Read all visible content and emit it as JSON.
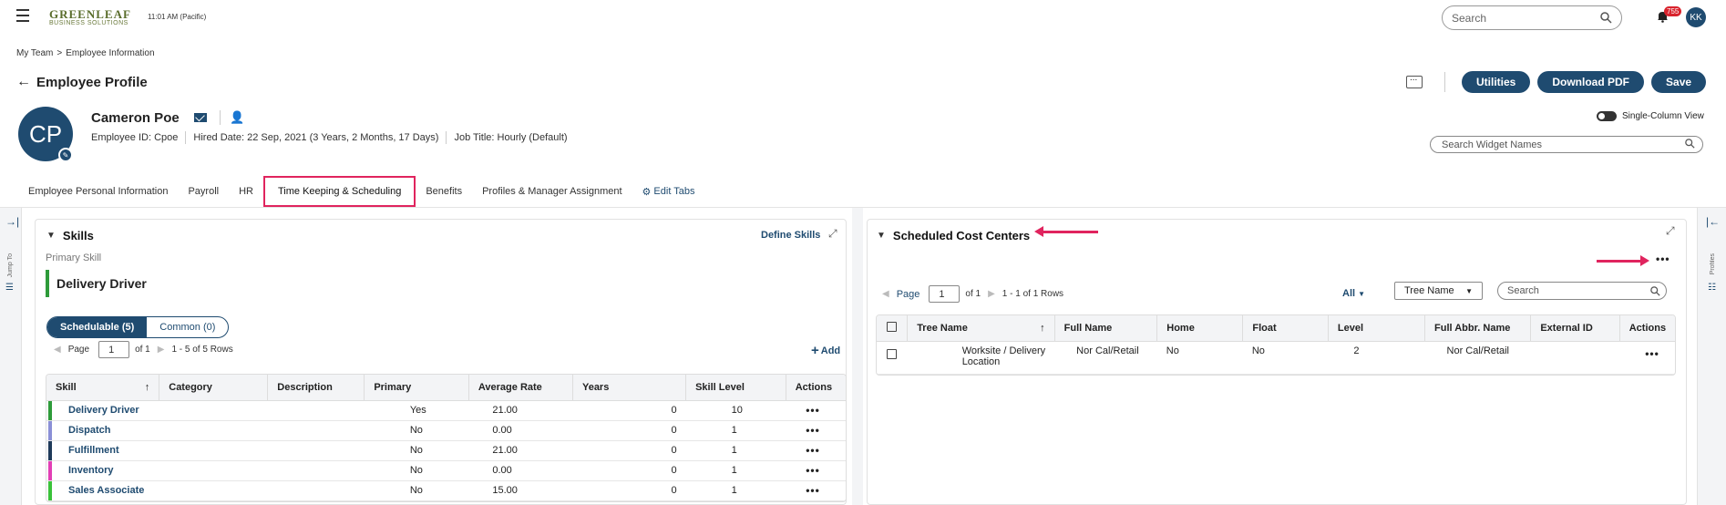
{
  "header": {
    "logo_brand": "GREENLEAF",
    "logo_sub": "BUSINESS SOLUTIONS",
    "clock": "11:01 AM (Pacific)",
    "search_placeholder": "Search",
    "notif_count": "755",
    "user_initials": "KK"
  },
  "breadcrumb": {
    "item1": "My Team",
    "sep": ">",
    "item2": "Employee Information"
  },
  "page_title": "Employee Profile",
  "actions": {
    "utilities": "Utilities",
    "download_pdf": "Download PDF",
    "save": "Save"
  },
  "profile": {
    "initials": "CP",
    "name": "Cameron Poe",
    "employee_id_label": "Employee ID:",
    "employee_id": "Cpoe",
    "hired_label": "Hired Date:",
    "hired_value": "22 Sep, 2021 (3 Years, 2 Months, 17 Days)",
    "job_title_label": "Job Title:",
    "job_title": "Hourly (Default)"
  },
  "view": {
    "single_column": "Single-Column View",
    "widget_search_placeholder": "Search Widget Names"
  },
  "tabs": [
    {
      "label": "Employee Personal Information"
    },
    {
      "label": "Payroll"
    },
    {
      "label": "HR"
    },
    {
      "label": "Time Keeping & Scheduling"
    },
    {
      "label": "Benefits"
    },
    {
      "label": "Profiles & Manager Assignment"
    }
  ],
  "edit_tabs": "Edit Tabs",
  "side": {
    "jump_to": "Jump To",
    "profiles": "Profiles"
  },
  "skills": {
    "title": "Skills",
    "define": "Define Skills",
    "primary_label": "Primary Skill",
    "primary_value": "Delivery Driver",
    "seg_schedulable": "Schedulable (5)",
    "seg_common": "Common (0)",
    "page_label": "Page",
    "page_value": "1",
    "of_label": "of 1",
    "rows_label": "1 - 5 of 5 Rows",
    "add": "Add",
    "columns": [
      "Skill",
      "Category",
      "Description",
      "Primary",
      "Average Rate",
      "Years",
      "Skill Level",
      "Actions"
    ],
    "rows": [
      {
        "skill": "Delivery Driver",
        "category": "",
        "description": "",
        "primary": "Yes",
        "rate": "21.00",
        "years": "0",
        "level": "10",
        "color": "#2e9b3a"
      },
      {
        "skill": "Dispatch",
        "category": "",
        "description": "",
        "primary": "No",
        "rate": "0.00",
        "years": "0",
        "level": "1",
        "color": "#8a8fd6"
      },
      {
        "skill": "Fulfillment",
        "category": "",
        "description": "",
        "primary": "No",
        "rate": "21.00",
        "years": "0",
        "level": "1",
        "color": "#1f3a5a"
      },
      {
        "skill": "Inventory",
        "category": "",
        "description": "",
        "primary": "No",
        "rate": "0.00",
        "years": "0",
        "level": "1",
        "color": "#e23fb5"
      },
      {
        "skill": "Sales Associate",
        "category": "",
        "description": "",
        "primary": "No",
        "rate": "15.00",
        "years": "0",
        "level": "1",
        "color": "#3ac23a"
      }
    ]
  },
  "cost_centers": {
    "title": "Scheduled Cost Centers",
    "page_label": "Page",
    "page_value": "1",
    "of_label": "of 1",
    "rows_label": "1 - 1 of 1 Rows",
    "all": "All",
    "sort_select": "Tree Name",
    "search_placeholder": "Search",
    "columns": [
      "Tree Name",
      "Full Name",
      "Home",
      "Float",
      "Level",
      "Full Abbr. Name",
      "External ID",
      "Actions"
    ],
    "rows": [
      {
        "tree_name_1": "Worksite / Delivery",
        "tree_name_2": "Location",
        "full_name": "Nor Cal/Retail",
        "home": "No",
        "float": "No",
        "level": "2",
        "abbr": "Nor Cal/Retail",
        "external_id": ""
      }
    ]
  },
  "colors": {
    "brand": "#1f4b70",
    "highlight": "#e0245e",
    "badge": "#d9232d"
  }
}
